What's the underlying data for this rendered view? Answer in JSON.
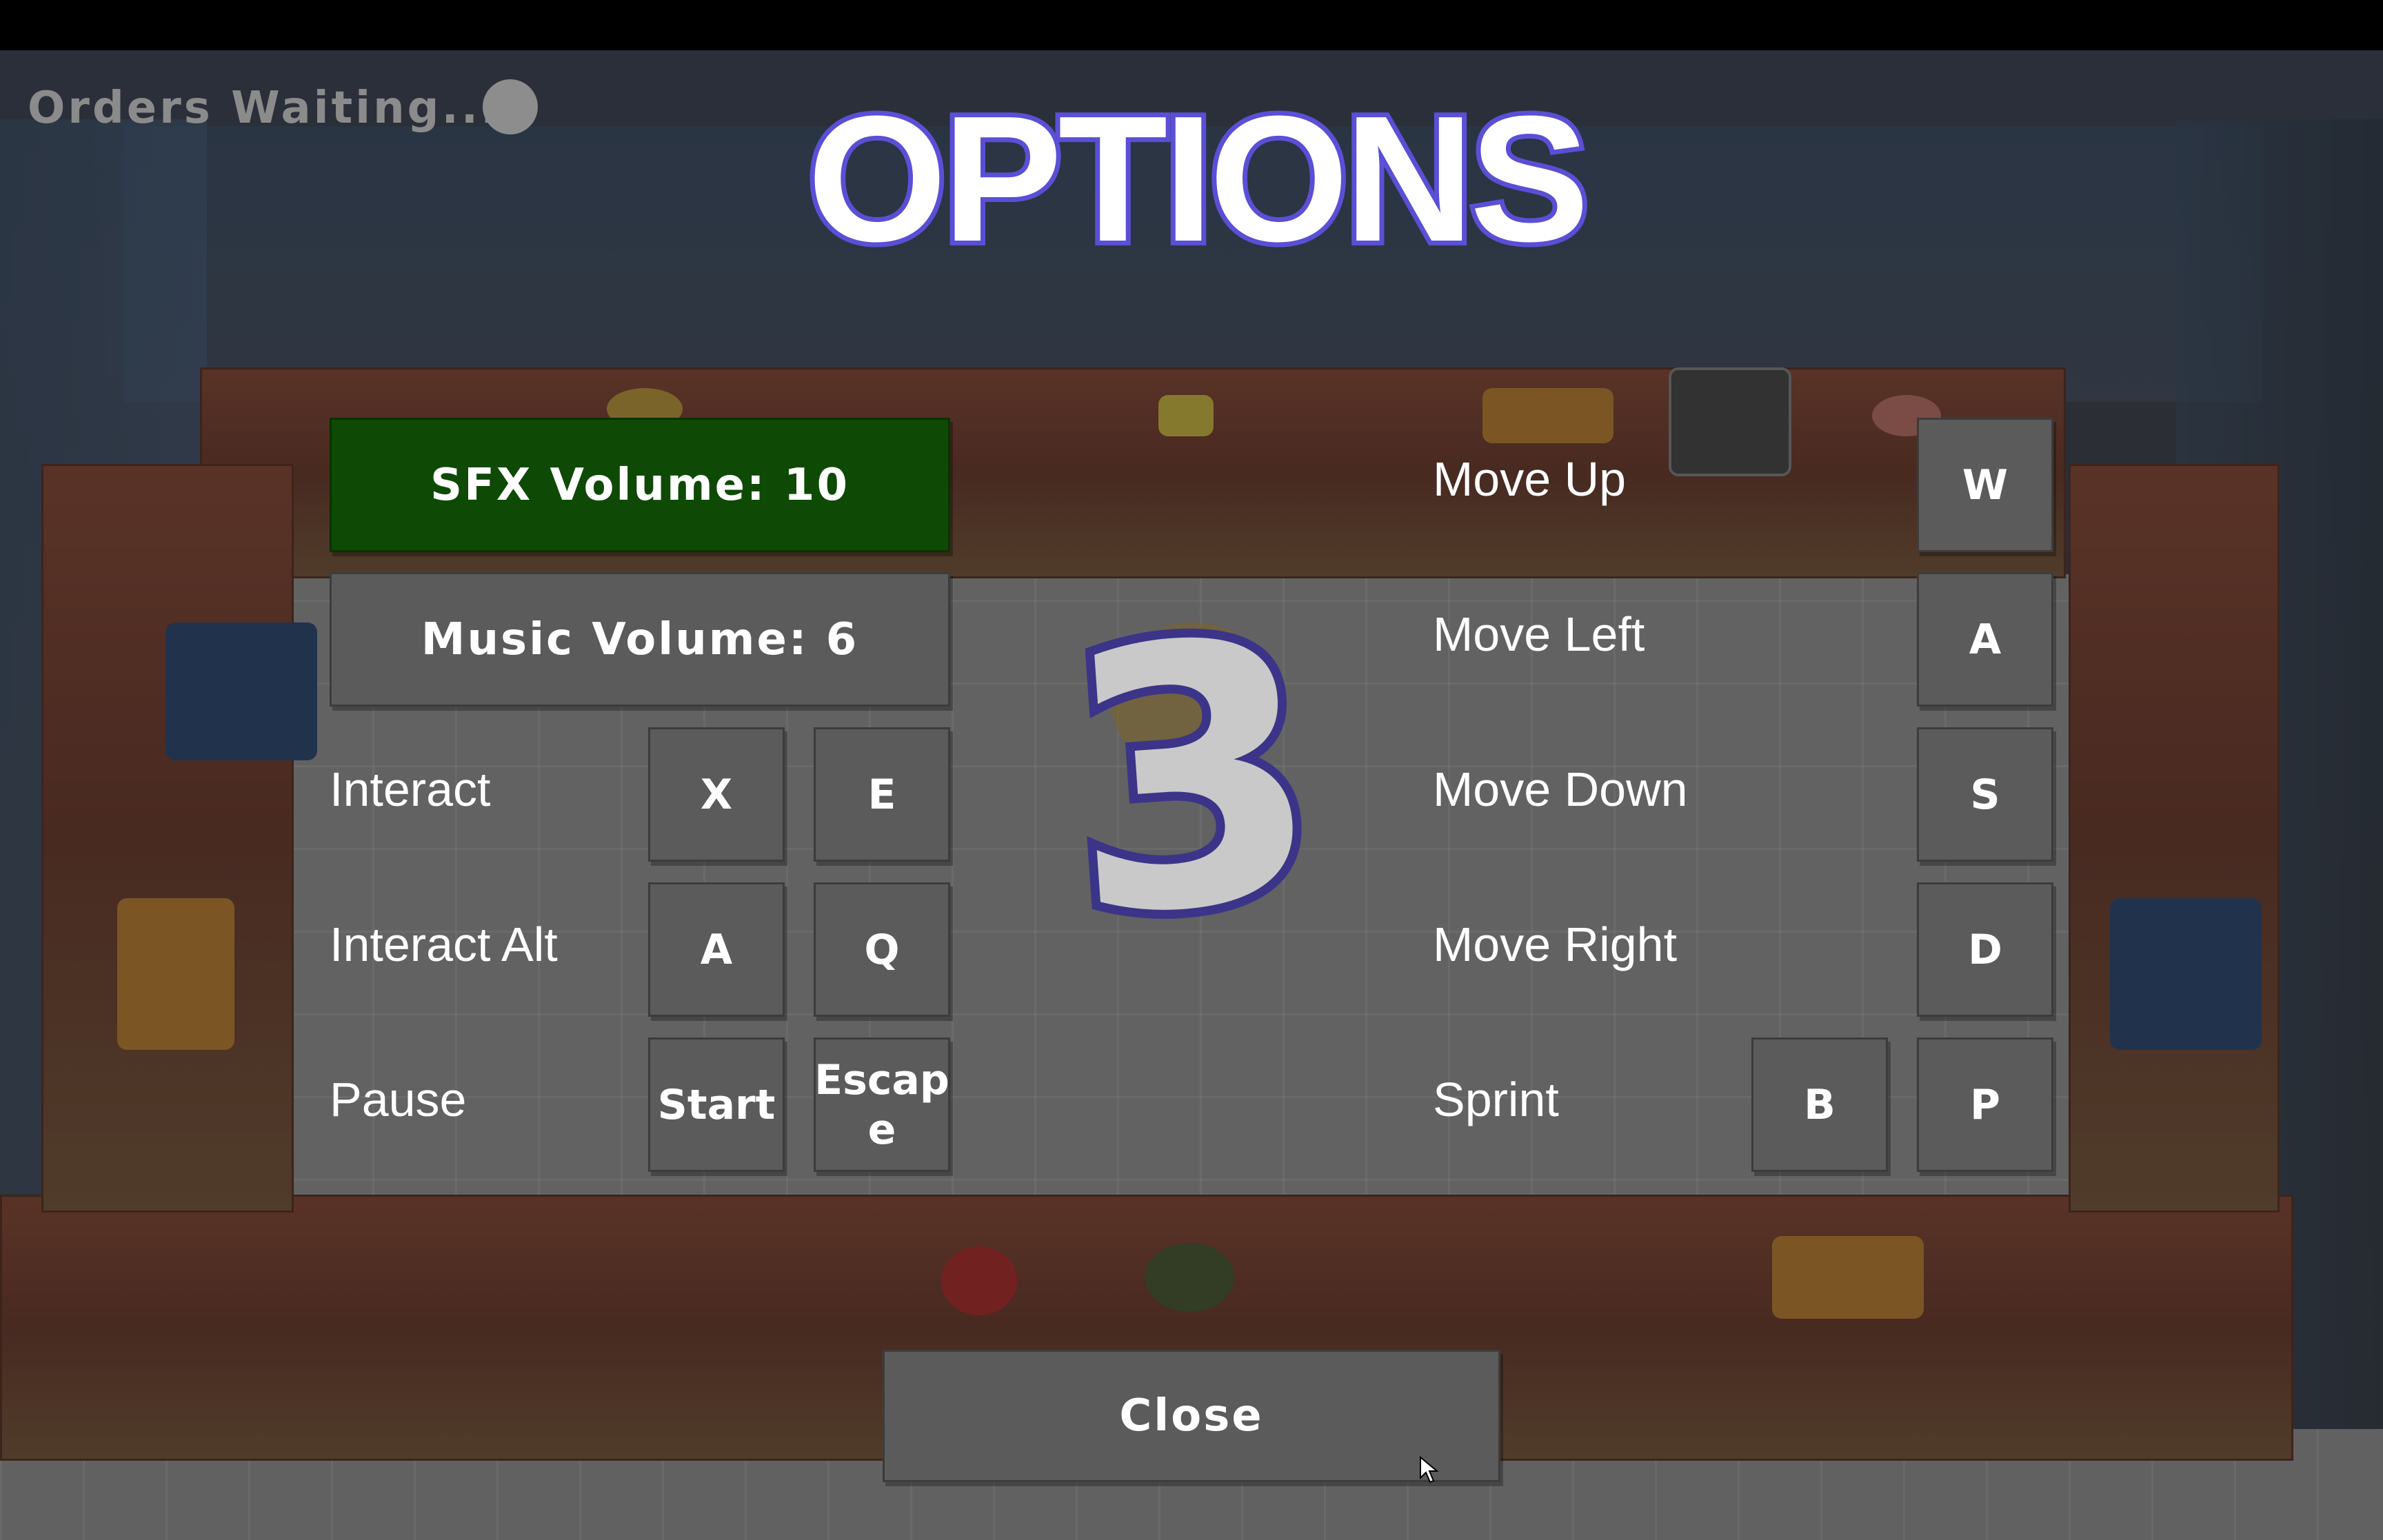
{
  "hud": {
    "orders_text": "Orders Waiting..."
  },
  "title": "OPTIONS",
  "countdown": "3",
  "audio": {
    "sfx_label": "SFX Volume: 10",
    "music_label": "Music Volume: 6"
  },
  "bindings_left": [
    {
      "action": "Interact",
      "primary": "X",
      "secondary": "E"
    },
    {
      "action": "Interact Alt",
      "primary": "A",
      "secondary": "Q"
    },
    {
      "action": "Pause",
      "primary": "Start",
      "secondary": "Escap\ne"
    }
  ],
  "bindings_right": [
    {
      "action": "Move Up",
      "key": "W"
    },
    {
      "action": "Move Left",
      "key": "A"
    },
    {
      "action": "Move Down",
      "key": "S"
    },
    {
      "action": "Move Right",
      "key": "D"
    },
    {
      "action": "Sprint",
      "alt_key": "B",
      "key": "P"
    }
  ],
  "close_label": "Close",
  "colors": {
    "title_outline": "#5a4fd6",
    "selected_button": "#0e4a05",
    "button": "#5b5b5b"
  }
}
